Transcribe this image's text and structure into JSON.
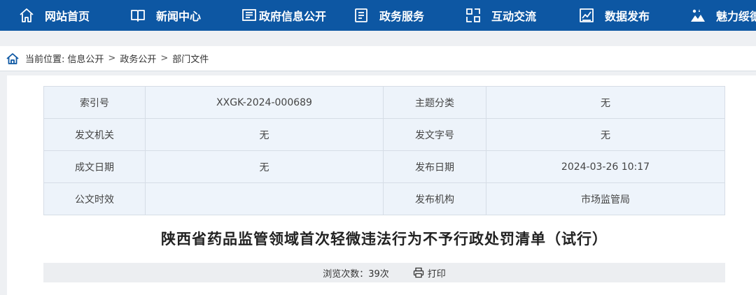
{
  "nav": {
    "items": [
      {
        "label": "网站首页",
        "icon": "home-icon"
      },
      {
        "label": "新闻中心",
        "icon": "book-icon"
      },
      {
        "label": "政府信息公开",
        "icon": "document-icon"
      },
      {
        "label": "政务服务",
        "icon": "list-icon"
      },
      {
        "label": "互动交流",
        "icon": "interaction-icon"
      },
      {
        "label": "数据发布",
        "icon": "chart-icon"
      },
      {
        "label": "魅力绥德",
        "icon": "landscape-icon"
      }
    ]
  },
  "breadcrumb": {
    "prefix": "当前位置:",
    "items": [
      "信息公开",
      "政务公开",
      "部门文件"
    ],
    "separator": ">"
  },
  "meta_table": [
    {
      "k1": "索引号",
      "v1": "XXGK-2024-000689",
      "k2": "主题分类",
      "v2": "无"
    },
    {
      "k1": "发文机关",
      "v1": "无",
      "k2": "发文字号",
      "v2": "无"
    },
    {
      "k1": "成文日期",
      "v1": "无",
      "k2": "发布日期",
      "v2": "2024-03-26 10:17"
    },
    {
      "k1": "公文时效",
      "v1": "",
      "k2": "发布机构",
      "v2": "市场监管局"
    }
  ],
  "article": {
    "title": "陕西省药品监管领域首次轻微违法行为不予行政处罚清单（试行）",
    "views_label": "浏览次数：39次",
    "print_label": "打印"
  },
  "colors": {
    "nav_bg": "#0d57a3",
    "table_key_bg": "#edf3fa",
    "table_val_bg": "#eef4fb"
  }
}
